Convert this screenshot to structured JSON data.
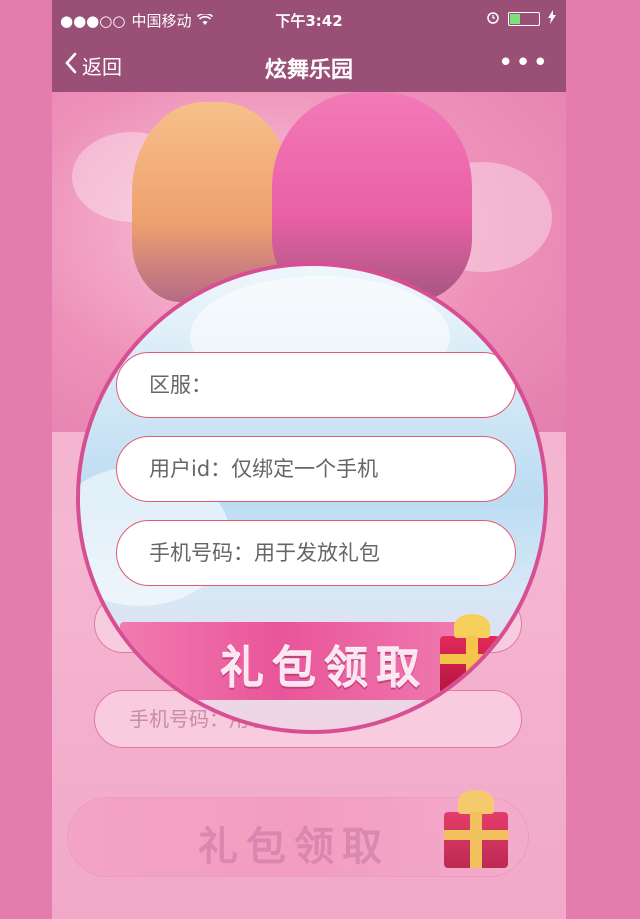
{
  "status_bar": {
    "signal": "●●●○○",
    "carrier": "中国移动",
    "wifi_icon": "wifi-icon",
    "time": "下午3:42",
    "alarm_icon": "alarm-icon",
    "battery_level": 0.4,
    "charging_icon": "charging-icon"
  },
  "nav": {
    "back_label": "返回",
    "title": "炫舞乐园",
    "more_label": "•••"
  },
  "form": {
    "server_placeholder": "区服：",
    "user_id_placeholder": "用户id：仅绑定一个手机",
    "phone_placeholder": "手机号码：用于发放礼包",
    "claim_button_label": "礼包领取"
  },
  "background_form": {
    "phone_placeholder": "手机号码：用于发放礼包",
    "claim_button_label": "礼包领取"
  },
  "colors": {
    "header": "#9a4f77",
    "page_bg": "#e57cae",
    "input_border": "#e25b73",
    "lens_border": "#d74f92"
  }
}
